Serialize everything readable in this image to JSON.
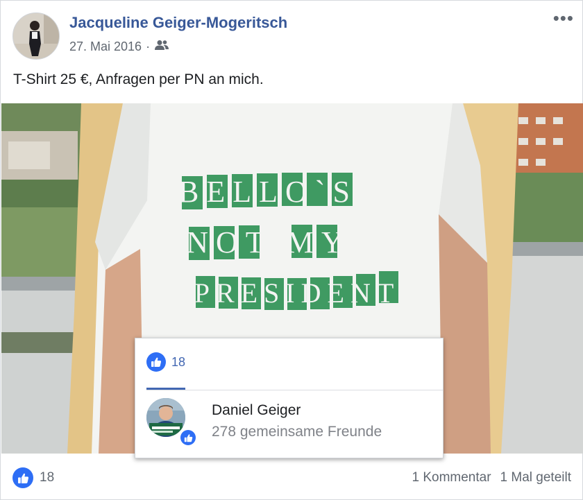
{
  "post": {
    "author": "Jacqueline Geiger-Mogeritsch",
    "date": "27. Mai 2016",
    "separator": "·",
    "audience_icon": "friends-icon",
    "more_icon": "more-options-icon",
    "more_label": "•••",
    "text": "T-Shirt 25 €, Anfragen per PN an mich."
  },
  "photo": {
    "shirt_text": [
      "BELLO`S",
      "NOT MY",
      "PRESIDENT"
    ],
    "colors": {
      "shirt": "#f3f4f2",
      "letter_box": "#3f9a62",
      "hair": "#e6c98c"
    }
  },
  "reactions_popup": {
    "like_icon": "like-icon",
    "count": "18",
    "friend": {
      "name": "Daniel Geiger",
      "mutual_friends": "278 gemeinsame Freunde"
    }
  },
  "footer": {
    "like_icon": "like-icon",
    "likes": "18",
    "comments": "1 Kommentar",
    "shares": "1 Mal geteilt"
  },
  "colors": {
    "link_blue": "#385898",
    "like_blue": "#2e6ef5",
    "muted": "#606770"
  }
}
